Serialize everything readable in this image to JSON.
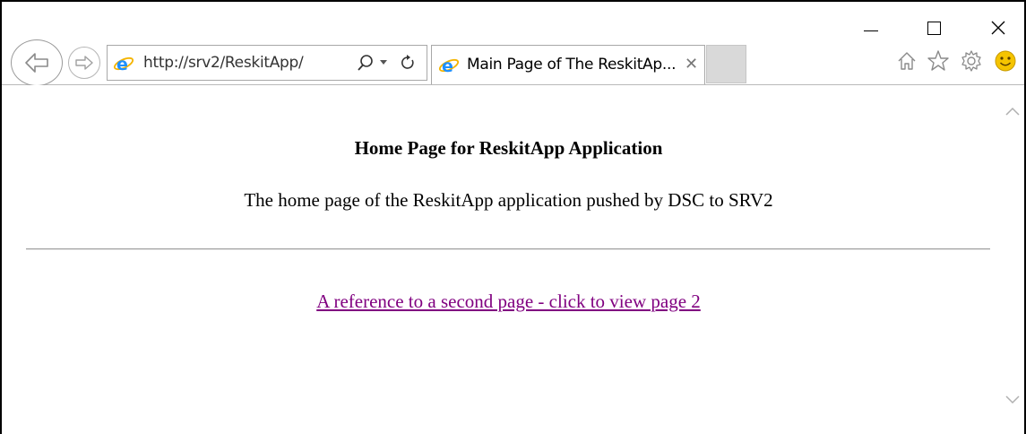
{
  "browser": {
    "address": {
      "url": "http://srv2/ReskitApp/"
    },
    "tab": {
      "title": "Main Page of The ReskitAp...",
      "close_glyph": "✕"
    },
    "window_controls": {
      "close_glyph": "✕"
    },
    "icons": {
      "back": "back-arrow-icon",
      "forward": "forward-arrow-icon",
      "site": "ie-logo-icon",
      "search": "search-icon",
      "dropdown": "chevron-down-icon",
      "refresh": "refresh-icon",
      "home": "home-icon",
      "favorites": "star-icon",
      "tools": "gear-icon",
      "feedback": "smiley-icon"
    },
    "colors": {
      "link_visited": "#800080",
      "smiley": "#f5c400",
      "ie_blue": "#1e90ff",
      "ie_ring": "#f4b400"
    }
  },
  "page": {
    "heading": "Home Page for ReskitApp Application",
    "description": "The home page of the ReskitApp application pushed by DSC to SRV2",
    "link_text": "A reference to a second page - click to view page 2"
  }
}
